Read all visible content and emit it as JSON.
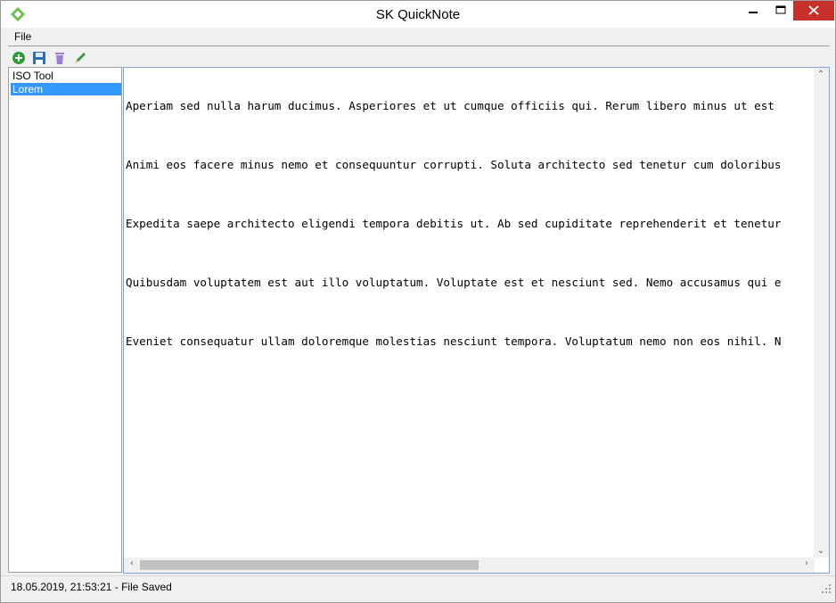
{
  "window": {
    "title": "SK QuickNote",
    "accent_color": "#c7312b",
    "selection_color": "#3399ff"
  },
  "menu": {
    "file": "File"
  },
  "toolbar": {
    "buttons": [
      {
        "name": "add-note-button",
        "icon": "plus-circle-icon",
        "color": "#2f9e3a"
      },
      {
        "name": "save-button",
        "icon": "floppy-disk-icon",
        "color": "#2f6fb8"
      },
      {
        "name": "delete-button",
        "icon": "trash-icon",
        "color": "#9b7fd1"
      },
      {
        "name": "rename-button",
        "icon": "pencil-icon",
        "color": "#3a9a3a"
      }
    ]
  },
  "notes": {
    "items": [
      {
        "label": "ISO Tool",
        "selected": false
      },
      {
        "label": "Lorem",
        "selected": true
      }
    ]
  },
  "editor": {
    "lines": [
      "Aperiam sed nulla harum ducimus. Asperiores et ut cumque officiis qui. Rerum libero minus ut est",
      "Animi eos facere minus nemo et consequuntur corrupti. Soluta architecto sed tenetur cum doloribus",
      "Expedita saepe architecto eligendi tempora debitis ut. Ab sed cupiditate reprehenderit et tenetur",
      "Quibusdam voluptatem est aut illo voluptatum. Voluptate est et nesciunt sed. Nemo accusamus qui e",
      "Eveniet consequatur ullam doloremque molestias nesciunt tempora. Voluptatum nemo non eos nihil. N"
    ]
  },
  "status": {
    "text": "18.05.2019, 21:53:21 - File Saved"
  }
}
